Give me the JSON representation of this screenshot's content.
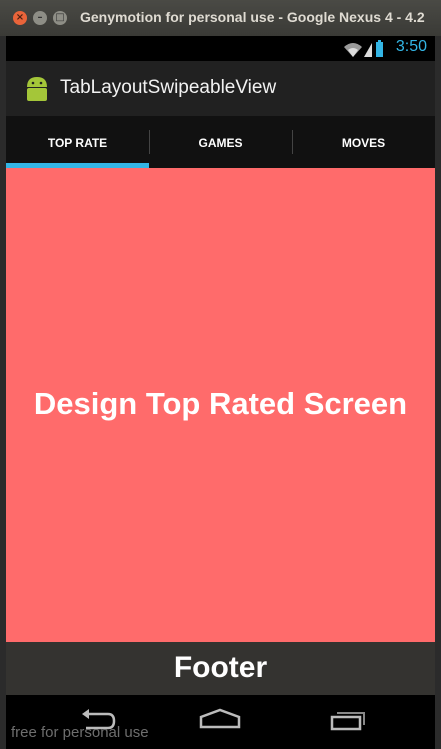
{
  "window": {
    "title": "Genymotion for personal use - Google Nexus 4 - 4.2"
  },
  "status_bar": {
    "time": "3:50"
  },
  "action_bar": {
    "app_title": "TabLayoutSwipeableView"
  },
  "tabs": [
    {
      "label": "TOP RATE",
      "selected": true
    },
    {
      "label": "GAMES",
      "selected": false
    },
    {
      "label": "MOVES",
      "selected": false
    }
  ],
  "content": {
    "text": "Design Top Rated Screen",
    "background": "#ff6b6b"
  },
  "footer": {
    "text": "Footer"
  },
  "watermark": "free for personal use",
  "colors": {
    "accent": "#33b5e5",
    "footer_bg": "#343330"
  },
  "nav_icons": [
    "back-icon",
    "home-icon",
    "recent-apps-icon"
  ]
}
